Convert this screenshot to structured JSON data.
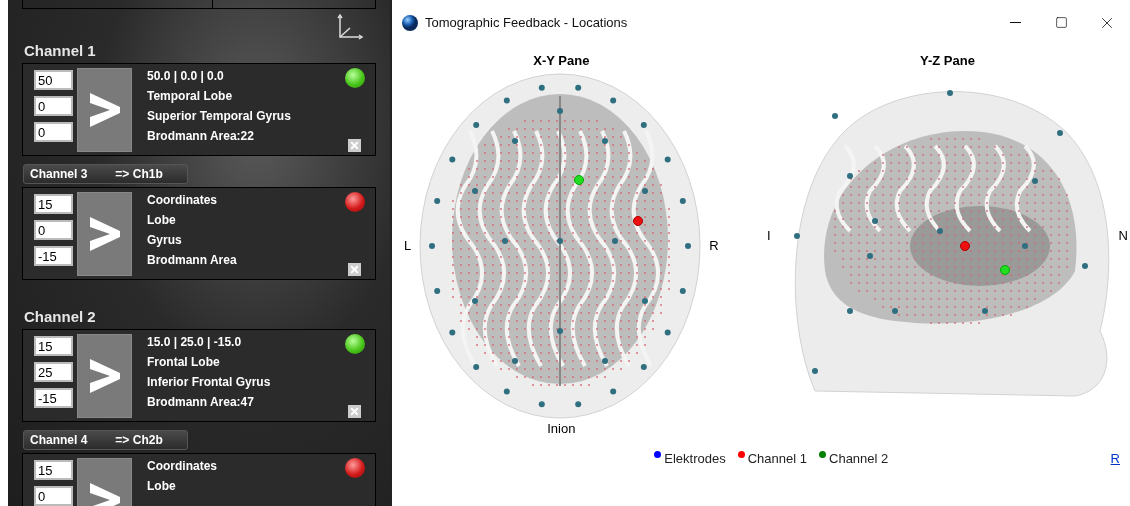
{
  "window": {
    "title": "Tomographic Feedback - Locations"
  },
  "channel_panel": {
    "groups": [
      {
        "kind": "heading",
        "title": "Channel 1",
        "inputs": [
          "50",
          "0",
          "0"
        ],
        "lines": [
          "50.0 | 0.0 | 0.0",
          "Temporal Lobe",
          "Superior Temporal Gyrus",
          "Brodmann Area:22"
        ],
        "located": true
      },
      {
        "kind": "button",
        "title": "Channel 3",
        "target": "=> Ch1b",
        "inputs": [
          "15",
          "0",
          "-15"
        ],
        "lines": [
          "Coordinates",
          "Lobe",
          "Gyrus",
          "Brodmann Area"
        ],
        "located": false
      },
      {
        "kind": "heading",
        "title": "Channel 2",
        "inputs": [
          "15",
          "25",
          "-15"
        ],
        "lines": [
          "15.0 | 25.0 | -15.0",
          "Frontal Lobe",
          "Inferior Frontal Gyrus",
          "Brodmann Area:47"
        ],
        "located": true
      },
      {
        "kind": "button",
        "title": "Channel 4",
        "target": "=> Ch2b",
        "inputs": [
          "15",
          "0"
        ],
        "lines": [
          "Coordinates",
          "Lobe"
        ],
        "located": false
      }
    ]
  },
  "panes": [
    {
      "kind": "axial",
      "title": "X-Y Pane",
      "left": "L",
      "right": "R",
      "bottom": "Inion"
    },
    {
      "kind": "sagittal",
      "title": "Y-Z Pane",
      "left": "I",
      "right": "N"
    }
  ],
  "legend": [
    {
      "label": "Elektrodes",
      "color": "#0000ff"
    },
    {
      "label": "Channel 1",
      "color": "#ff0000"
    },
    {
      "label": "Channel 2",
      "color": "#008000"
    }
  ],
  "reset_link": "R"
}
